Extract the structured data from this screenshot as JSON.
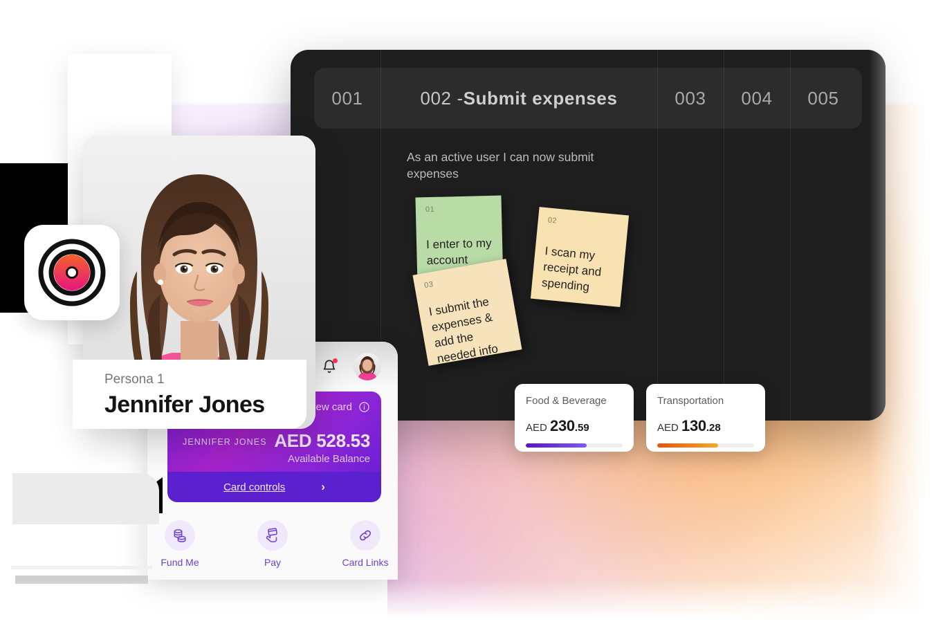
{
  "board": {
    "tabs": [
      {
        "id": "001",
        "label": "001",
        "active": false
      },
      {
        "id": "002",
        "label": "002 - ",
        "title": "Submit expenses",
        "active": true
      },
      {
        "id": "003",
        "label": "003",
        "active": false
      },
      {
        "id": "004",
        "label": "004",
        "active": false
      },
      {
        "id": "005",
        "label": "005",
        "active": false
      }
    ],
    "subtitle": "As an active user I can now submit expenses",
    "notes": [
      {
        "num": "01",
        "text": "I enter to my account",
        "color": "#b9dca7"
      },
      {
        "num": "02",
        "text": "I scan my receipt and spending",
        "color": "#f8e2b2"
      },
      {
        "num": "03",
        "text": "I submit the expenses & add the needed info",
        "color": "#f6e3bb"
      }
    ]
  },
  "expenses": [
    {
      "title": "Food & Beverage",
      "currency": "AED",
      "major": "230",
      "minor": ".59",
      "value": 230.59,
      "progress_pct": 63,
      "bar_from": "#5b12c4",
      "bar_to": "#7b5cf0"
    },
    {
      "title": "Transportation",
      "currency": "AED",
      "major": "130",
      "minor": ".28",
      "value": 130.28,
      "progress_pct": 63,
      "bar_from": "#e8500f",
      "bar_to": "#f7a823"
    }
  ],
  "persona": {
    "kicker": "Persona 1",
    "name": "Jennifer Jones",
    "avatar_alt": "portrait-of-jennifer-jones"
  },
  "brand": {
    "logo_name": "bullseye-target-logo",
    "ring_color": "#111111",
    "gradient_from": "#f4622a",
    "gradient_to": "#e8157f"
  },
  "phone": {
    "header": {
      "search_icon": "search-icon",
      "bell_icon": "notification-bell-icon",
      "bell_badge": true,
      "avatar": "user-avatar"
    },
    "card": {
      "overview_label": "Overview card",
      "info_icon": "info-icon",
      "cardholder": "JENNIFER JONES",
      "currency": "AED",
      "balance": "528.53",
      "balance_label": "Available Balance",
      "controls_label": "Card controls",
      "chevron": "›"
    },
    "quick_actions": [
      {
        "label": "Fund Me",
        "icon": "coins-icon"
      },
      {
        "label": "Pay",
        "icon": "hand-card-icon"
      },
      {
        "label": "Card Links",
        "icon": "link-icon"
      }
    ]
  },
  "theme": {
    "board_bg": "#1e1e1e",
    "tabbar_bg": "#2c2c2c",
    "accent_purple": "#5b21cf",
    "accent_magenta": "#a623c9"
  }
}
